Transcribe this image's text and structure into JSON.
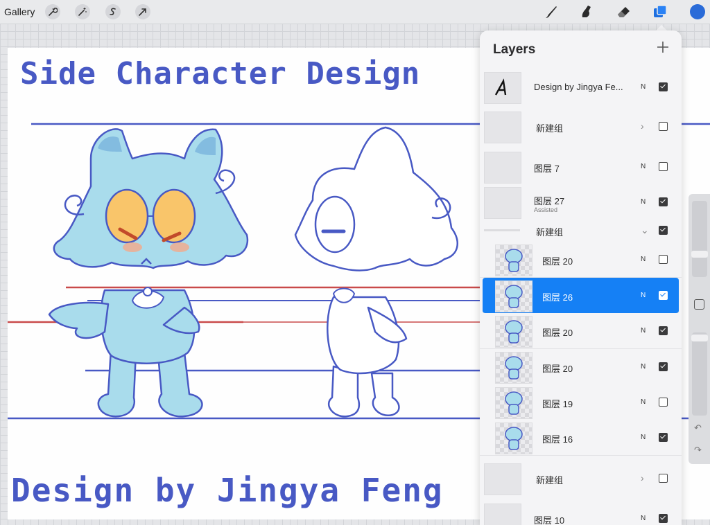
{
  "topbar": {
    "gallery_label": "Gallery",
    "left_tools": [
      "wrench-icon",
      "magic-wand-icon",
      "selection-s-icon",
      "transform-arrow-icon"
    ],
    "right_tools": [
      "brush-icon",
      "smudge-icon",
      "eraser-icon",
      "layers-icon"
    ],
    "active_color": "#2a6bd8"
  },
  "canvas": {
    "title": "Side Character Design",
    "credit": "Design by Jingya Feng",
    "ink_color": "#4859c4",
    "guide_red": "#c94a4a",
    "fill_blue": "#a9dcec"
  },
  "layers_panel": {
    "title": "Layers",
    "add_label": "+",
    "layers": [
      {
        "name": "Design by Jingya Fe...",
        "blend": "N",
        "visible": true,
        "kind": "text"
      },
      {
        "name": "新建组",
        "blend": "",
        "visible": false,
        "kind": "group-collapsed"
      },
      {
        "name": "图层 7",
        "blend": "N",
        "visible": false,
        "kind": "layer"
      },
      {
        "name": "图层 27",
        "sub": "Assisted",
        "blend": "N",
        "visible": true,
        "kind": "layer"
      },
      {
        "name": "新建组",
        "blend": "",
        "visible": true,
        "kind": "group-open"
      },
      {
        "name": "图层 20",
        "blend": "N",
        "visible": false,
        "kind": "child"
      },
      {
        "name": "图层 26",
        "blend": "N",
        "visible": true,
        "kind": "child",
        "selected": true
      },
      {
        "name": "图层 20",
        "blend": "N",
        "visible": true,
        "kind": "child"
      },
      {
        "name": "图层 20",
        "blend": "N",
        "visible": true,
        "kind": "child"
      },
      {
        "name": "图层 19",
        "blend": "N",
        "visible": false,
        "kind": "child"
      },
      {
        "name": "图层 16",
        "blend": "N",
        "visible": true,
        "kind": "child"
      },
      {
        "name": "新建组",
        "blend": "",
        "visible": false,
        "kind": "group-collapsed"
      },
      {
        "name": "图层 10",
        "blend": "N",
        "visible": true,
        "kind": "layer"
      }
    ]
  }
}
